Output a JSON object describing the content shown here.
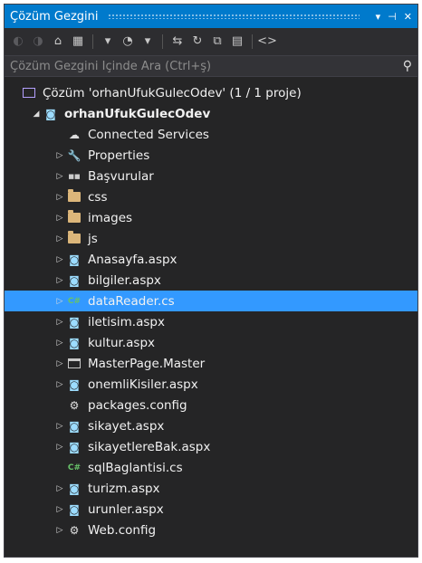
{
  "window": {
    "title": "Çözüm Gezgini",
    "pin_label": "▾",
    "dock_label": "⊣",
    "close_label": "✕"
  },
  "toolbar": {
    "tools": [
      {
        "name": "back-icon",
        "glyph": "◐",
        "dim": true
      },
      {
        "name": "forward-icon",
        "glyph": "◑",
        "dim": true
      },
      {
        "name": "home-icon",
        "glyph": "⌂",
        "dim": false
      },
      {
        "name": "switch-views-icon",
        "glyph": "▦",
        "dim": false
      },
      {
        "name": "dropdown-icon",
        "glyph": "▾",
        "dim": false
      },
      {
        "name": "pending-changes-icon",
        "glyph": "◔",
        "dim": false
      },
      {
        "name": "dropdown2-icon",
        "glyph": "▾",
        "dim": false
      },
      {
        "name": "sync-icon",
        "glyph": "⇆",
        "dim": false
      },
      {
        "name": "refresh-icon",
        "glyph": "↻",
        "dim": false
      },
      {
        "name": "collapse-all-icon",
        "glyph": "⧉",
        "dim": false
      },
      {
        "name": "show-all-files-icon",
        "glyph": "▤",
        "dim": false
      },
      {
        "name": "code-view-icon",
        "glyph": "<>",
        "dim": false
      }
    ]
  },
  "search": {
    "placeholder": "Çözüm Gezgini İçinde Ara (Ctrl+ş)",
    "icon": "⚲"
  },
  "tree": {
    "items": [
      {
        "label": "Çözüm 'orhanUfukGulecOdev' (1 / 1 proje)",
        "icon": "solution-icon",
        "arrow": "",
        "indent": 0,
        "bold": false,
        "selected": false
      },
      {
        "label": "orhanUfukGulecOdev",
        "icon": "web-project-icon",
        "arrow": "◢",
        "indent": 1,
        "bold": true,
        "selected": false
      },
      {
        "label": "Connected Services",
        "icon": "connected-services-icon",
        "arrow": "",
        "indent": 2,
        "bold": false,
        "selected": false
      },
      {
        "label": "Properties",
        "icon": "wrench-icon",
        "arrow": "▷",
        "indent": 2,
        "bold": false,
        "selected": false
      },
      {
        "label": "Başvurular",
        "icon": "references-icon",
        "arrow": "▷",
        "indent": 2,
        "bold": false,
        "selected": false
      },
      {
        "label": "css",
        "icon": "folder-icon",
        "arrow": "▷",
        "indent": 2,
        "bold": false,
        "selected": false
      },
      {
        "label": "images",
        "icon": "folder-icon",
        "arrow": "▷",
        "indent": 2,
        "bold": false,
        "selected": false
      },
      {
        "label": "js",
        "icon": "folder-icon",
        "arrow": "▷",
        "indent": 2,
        "bold": false,
        "selected": false
      },
      {
        "label": "Anasayfa.aspx",
        "icon": "aspx-file-icon",
        "arrow": "▷",
        "indent": 2,
        "bold": false,
        "selected": false
      },
      {
        "label": "bilgiler.aspx",
        "icon": "aspx-file-icon",
        "arrow": "▷",
        "indent": 2,
        "bold": false,
        "selected": false
      },
      {
        "label": "dataReader.cs",
        "icon": "csharp-file-icon",
        "arrow": "▷",
        "indent": 2,
        "bold": false,
        "selected": true
      },
      {
        "label": "iletisim.aspx",
        "icon": "aspx-file-icon",
        "arrow": "▷",
        "indent": 2,
        "bold": false,
        "selected": false
      },
      {
        "label": "kultur.aspx",
        "icon": "aspx-file-icon",
        "arrow": "▷",
        "indent": 2,
        "bold": false,
        "selected": false
      },
      {
        "label": "MasterPage.Master",
        "icon": "master-page-icon",
        "arrow": "▷",
        "indent": 2,
        "bold": false,
        "selected": false
      },
      {
        "label": "onemliKisiler.aspx",
        "icon": "aspx-file-icon",
        "arrow": "▷",
        "indent": 2,
        "bold": false,
        "selected": false
      },
      {
        "label": "packages.config",
        "icon": "config-file-icon",
        "arrow": "",
        "indent": 2,
        "bold": false,
        "selected": false
      },
      {
        "label": "sikayet.aspx",
        "icon": "aspx-file-icon",
        "arrow": "▷",
        "indent": 2,
        "bold": false,
        "selected": false
      },
      {
        "label": "sikayetlereBak.aspx",
        "icon": "aspx-file-icon",
        "arrow": "▷",
        "indent": 2,
        "bold": false,
        "selected": false
      },
      {
        "label": "sqlBaglantisi.cs",
        "icon": "csharp-file-icon",
        "arrow": "",
        "indent": 2,
        "bold": false,
        "selected": false
      },
      {
        "label": "turizm.aspx",
        "icon": "aspx-file-icon",
        "arrow": "▷",
        "indent": 2,
        "bold": false,
        "selected": false
      },
      {
        "label": "urunler.aspx",
        "icon": "aspx-file-icon",
        "arrow": "▷",
        "indent": 2,
        "bold": false,
        "selected": false
      },
      {
        "label": "Web.config",
        "icon": "config-file-icon",
        "arrow": "▷",
        "indent": 2,
        "bold": false,
        "selected": false
      }
    ]
  },
  "colors": {
    "background": "#252526",
    "titlebar": "#007acc",
    "selection": "#3399ff",
    "text": "#f1f1f1"
  }
}
